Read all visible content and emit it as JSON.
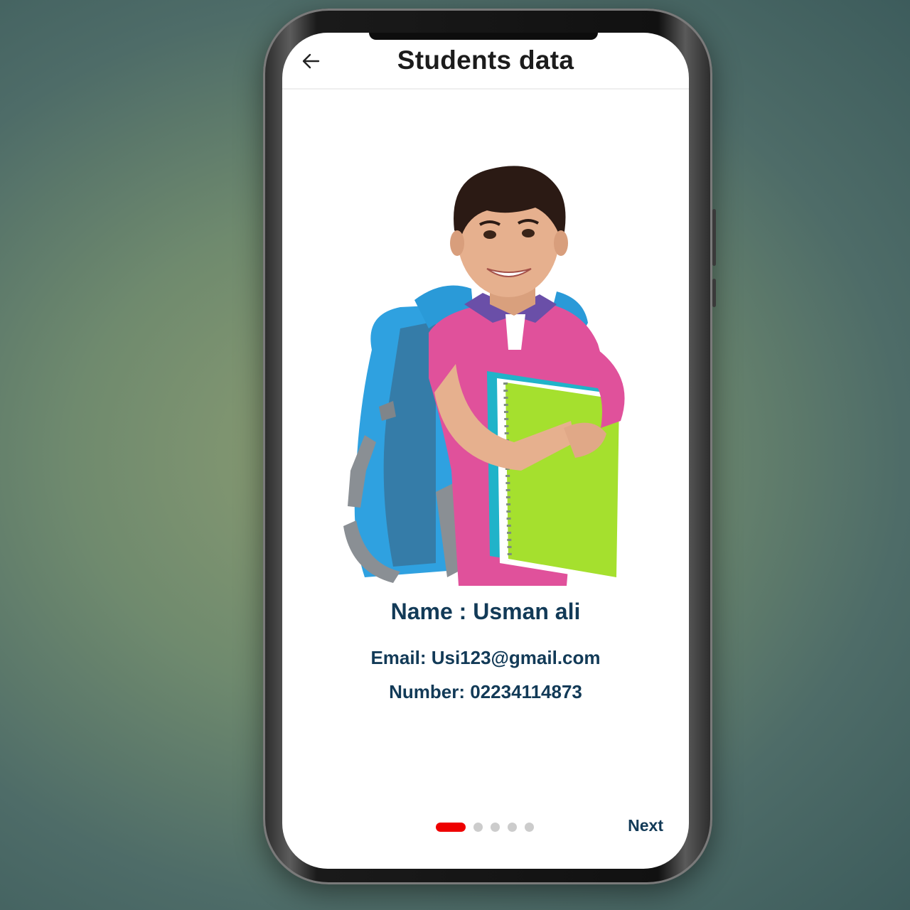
{
  "header": {
    "title": "Students data",
    "back_icon": "arrow-left-icon"
  },
  "student": {
    "photo": "student-photo",
    "name_line": "Name : Usman ali",
    "email_line": "Email: Usi123@gmail.com",
    "number_line": "Number: 02234114873"
  },
  "pager": {
    "total_pages": 5,
    "active_page": 1,
    "next_label": "Next"
  },
  "colors": {
    "accent": "#ee0000",
    "text": "#123a57",
    "dot_inactive": "#cccccc"
  }
}
